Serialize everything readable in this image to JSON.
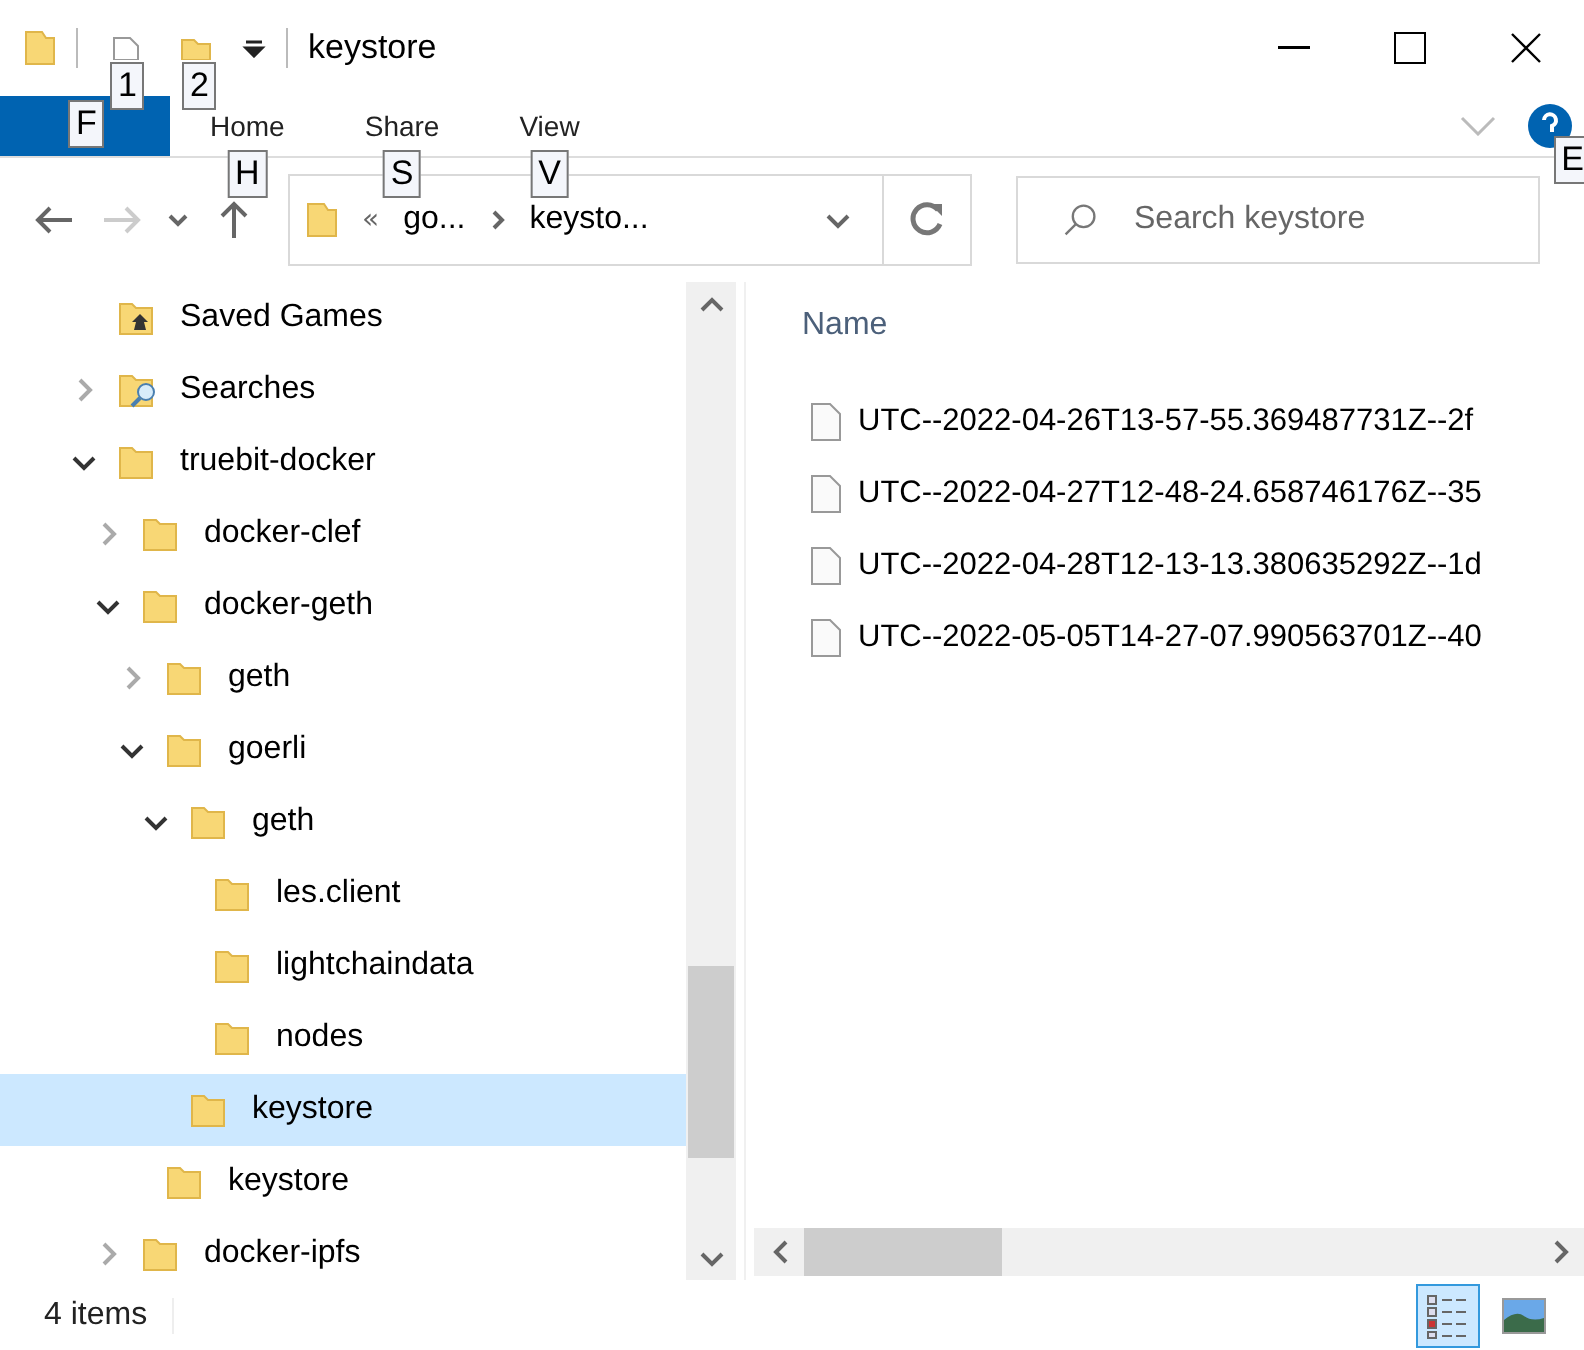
{
  "window": {
    "title": "keystore",
    "quick_access": [
      {
        "kind": "properties",
        "badge": "1"
      },
      {
        "kind": "new-folder",
        "badge": "2"
      }
    ]
  },
  "ribbon": {
    "tabs": [
      {
        "badge": "F",
        "kind": "file"
      },
      {
        "label": "Home",
        "badge": "H",
        "kind": "tab"
      },
      {
        "label": "Share",
        "badge": "S",
        "kind": "tab"
      },
      {
        "label": "View",
        "badge": "V",
        "kind": "tab"
      }
    ],
    "help_badge": "E"
  },
  "navigation": {
    "buttons": [
      {
        "kind": "back",
        "disabled": false
      },
      {
        "kind": "forward",
        "disabled": true
      },
      {
        "kind": "recent",
        "disabled": false
      },
      {
        "kind": "up",
        "disabled": false
      }
    ],
    "overflow": "«",
    "path": [
      {
        "label": "go..."
      },
      {
        "label": "keysto..."
      }
    ],
    "search": {
      "placeholder": "Search keystore"
    }
  },
  "tree": [
    {
      "label": "Saved Games",
      "kind": "saved-games",
      "selected": false
    },
    {
      "label": "Searches",
      "kind": "searches",
      "expanded": false,
      "selected": false
    },
    {
      "label": "truebit-docker",
      "kind": "folder",
      "expanded": true,
      "selected": false,
      "children": [
        {
          "label": "docker-clef",
          "kind": "folder",
          "expanded": false,
          "selected": false
        },
        {
          "label": "docker-geth",
          "kind": "folder",
          "expanded": true,
          "selected": false,
          "children": [
            {
              "label": "geth",
              "kind": "folder",
              "expanded": false,
              "selected": false
            },
            {
              "label": "goerli",
              "kind": "folder",
              "expanded": true,
              "selected": false,
              "children": [
                {
                  "label": "geth",
                  "kind": "folder",
                  "expanded": true,
                  "selected": false,
                  "children": [
                    {
                      "label": "les.client",
                      "kind": "folder",
                      "selected": false
                    },
                    {
                      "label": "lightchaindata",
                      "kind": "folder",
                      "selected": false
                    },
                    {
                      "label": "nodes",
                      "kind": "folder",
                      "selected": false
                    }
                  ]
                },
                {
                  "label": "keystore",
                  "kind": "folder",
                  "selected": true
                }
              ]
            },
            {
              "label": "keystore",
              "kind": "folder",
              "selected": false
            }
          ]
        },
        {
          "label": "docker-ipfs",
          "kind": "folder",
          "expanded": false,
          "selected": false
        }
      ]
    }
  ],
  "files": {
    "columns": [
      "Name"
    ],
    "rows": [
      {
        "name": "UTC--2022-04-26T13-57-55.369487731Z--2f"
      },
      {
        "name": "UTC--2022-04-27T12-48-24.658746176Z--35"
      },
      {
        "name": "UTC--2022-04-28T12-13-13.380635292Z--1d"
      },
      {
        "name": "UTC--2022-05-05T14-27-07.990563701Z--40"
      }
    ]
  },
  "status_bar": {
    "count": "4 items",
    "views": [
      {
        "kind": "details",
        "selected": true
      },
      {
        "kind": "large-icons",
        "selected": false
      }
    ]
  }
}
